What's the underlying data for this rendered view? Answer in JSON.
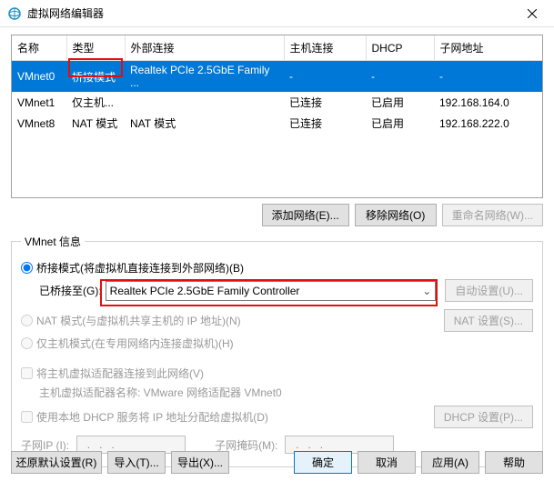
{
  "window": {
    "title": "虚拟网络编辑器"
  },
  "table": {
    "headers": [
      "名称",
      "类型",
      "外部连接",
      "主机连接",
      "DHCP",
      "子网地址"
    ],
    "rows": [
      {
        "name": "VMnet0",
        "type": "桥接模式",
        "ext": "Realtek PCIe 2.5GbE Family ...",
        "host": "-",
        "dhcp": "-",
        "subnet": "-",
        "selected": true
      },
      {
        "name": "VMnet1",
        "type": "仅主机...",
        "ext": "",
        "host": "已连接",
        "dhcp": "已启用",
        "subnet": "192.168.164.0",
        "selected": false
      },
      {
        "name": "VMnet8",
        "type": "NAT 模式",
        "ext": "NAT 模式",
        "host": "已连接",
        "dhcp": "已启用",
        "subnet": "192.168.222.0",
        "selected": false
      }
    ]
  },
  "buttons_mid": {
    "add": "添加网络(E)...",
    "remove": "移除网络(O)",
    "rename": "重命名网络(W)..."
  },
  "groupbox": {
    "legend": "VMnet 信息",
    "radio_bridge": "桥接模式(将虚拟机直接连接到外部网络)(B)",
    "bridge_to_label": "已桥接至(G):",
    "bridge_to_value": "Realtek PCIe 2.5GbE Family Controller",
    "auto_settings": "自动设置(U)...",
    "radio_nat": "NAT 模式(与虚拟机共享主机的 IP 地址)(N)",
    "nat_settings": "NAT 设置(S)...",
    "radio_hostonly": "仅主机模式(在专用网络内连接虚拟机)(H)",
    "check_hostadapter": "将主机虚拟适配器连接到此网络(V)",
    "hostadapter_name_label": "主机虚拟适配器名称: VMware 网络适配器 VMnet0",
    "check_dhcp": "使用本地 DHCP 服务将 IP 地址分配给虚拟机(D)",
    "dhcp_settings": "DHCP 设置(P)...",
    "subnet_ip_label": "子网IP (I):",
    "subnet_ip_value": "  .   .   .  ",
    "subnet_mask_label": "子网掩码(M):",
    "subnet_mask_value": "  .   .   .  "
  },
  "footer": {
    "restore": "还原默认设置(R)",
    "import": "导入(T)...",
    "export": "导出(X)...",
    "ok": "确定",
    "cancel": "取消",
    "apply": "应用(A)",
    "help": "帮助"
  }
}
